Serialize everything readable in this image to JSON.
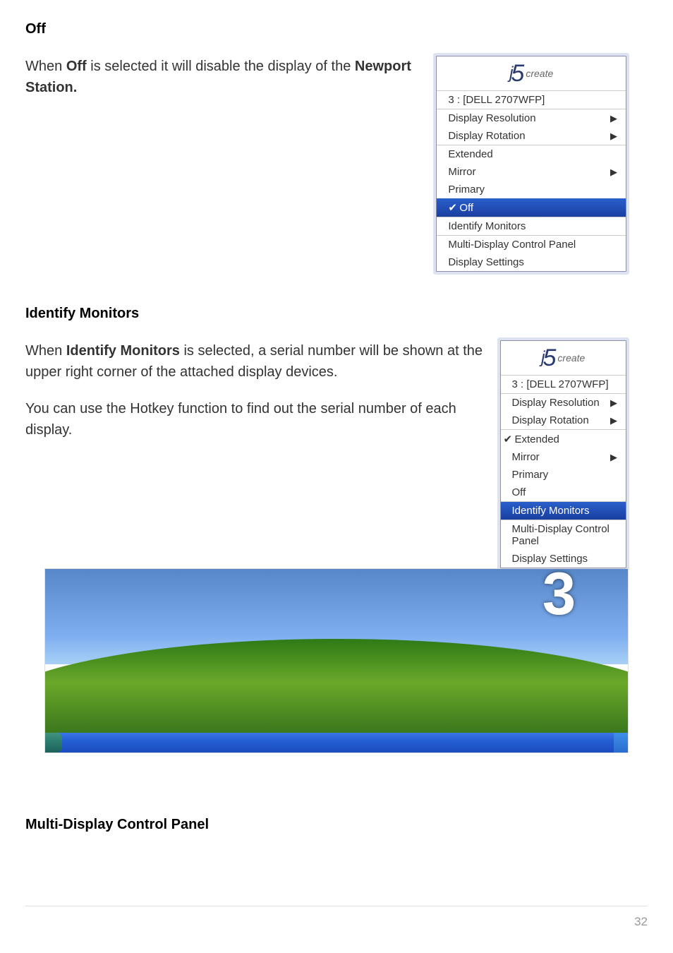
{
  "section_off": {
    "heading": "Off",
    "text_parts": [
      "When ",
      "Off",
      " is selected it will disable the display of the ",
      "Newport Station."
    ]
  },
  "section_identify": {
    "heading": "Identify Monitors",
    "para1_parts": [
      "When ",
      "Identify Monitors",
      " is selected, a serial number will be shown at the upper right corner of the attached display devices."
    ],
    "para2": "You can use the Hotkey function to find out the serial number of each display."
  },
  "section_multi": {
    "heading": "Multi-Display Control Panel"
  },
  "menu_common": {
    "logo_create": "create",
    "device": "3 : [DELL 2707WFP]",
    "items": {
      "display_resolution": "Display Resolution",
      "display_rotation": "Display Rotation",
      "extended": "Extended",
      "mirror": "Mirror",
      "primary": "Primary",
      "off": "Off",
      "identify_monitors": "Identify Monitors",
      "multi_display_cp": "Multi-Display Control Panel",
      "display_settings": "Display Settings"
    }
  },
  "overlay_number": "3",
  "page_number": "32"
}
